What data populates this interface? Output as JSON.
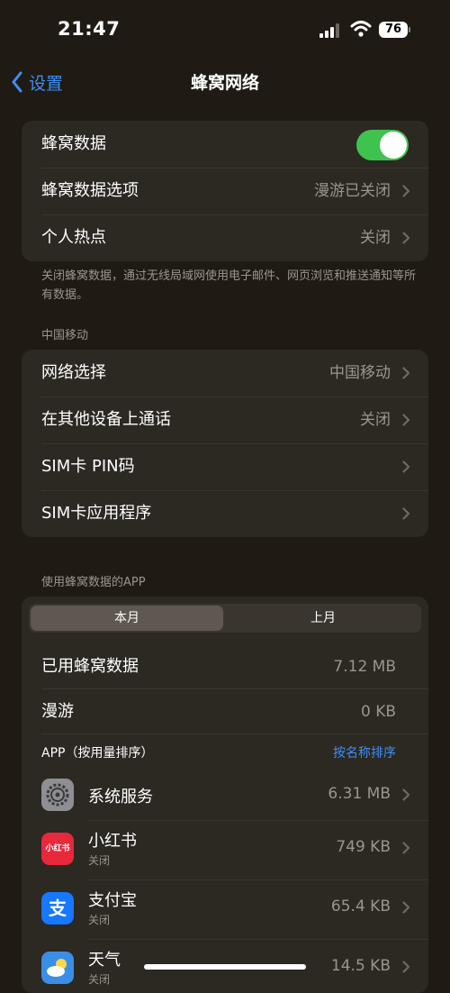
{
  "status": {
    "time": "21:47",
    "battery": "76"
  },
  "nav": {
    "back_label": "设置",
    "title": "蜂窝网络"
  },
  "group1": {
    "cellular_data": {
      "label": "蜂窝数据",
      "on": true
    },
    "cellular_options": {
      "label": "蜂窝数据选项",
      "value": "漫游已关闭"
    },
    "hotspot": {
      "label": "个人热点",
      "value": "关闭"
    }
  },
  "footnote1": "关闭蜂窝数据，通过无线局域网使用电子邮件、网页浏览和推送通知等所有数据。",
  "carrier_header": "中国移动",
  "group2": {
    "network_selection": {
      "label": "网络选择",
      "value": "中国移动"
    },
    "calls_other_devices": {
      "label": "在其他设备上通话",
      "value": "关闭"
    },
    "sim_pin": {
      "label": "SIM卡 PIN码"
    },
    "sim_apps": {
      "label": "SIM卡应用程序"
    }
  },
  "usage_header": "使用蜂窝数据的APP",
  "usage": {
    "tabs": [
      "本月",
      "上月"
    ],
    "selected_tab": "本月",
    "used": {
      "label": "已用蜂窝数据",
      "value": "7.12 MB"
    },
    "roaming": {
      "label": "漫游",
      "value": "0 KB"
    },
    "apps_header": "APP（按用量排序）",
    "sort_action": "按名称排序",
    "apps": [
      {
        "name": "系统服务",
        "usage": "6.31 MB",
        "icon": "settings-icon"
      },
      {
        "name": "小红书",
        "status": "关闭",
        "usage": "749 KB",
        "icon": "xiaohongshu-icon",
        "icon_text": "小红书"
      },
      {
        "name": "支付宝",
        "status": "关闭",
        "usage": "65.4 KB",
        "icon": "alipay-icon",
        "icon_text": "支"
      },
      {
        "name": "天气",
        "status": "关闭",
        "usage": "14.5 KB",
        "icon": "weather-icon"
      }
    ]
  },
  "colors": {
    "accent": "#3f8ff5",
    "toggle_on": "#3fc34f",
    "background": "#1f1a14",
    "group_bg": "#2c2822"
  }
}
